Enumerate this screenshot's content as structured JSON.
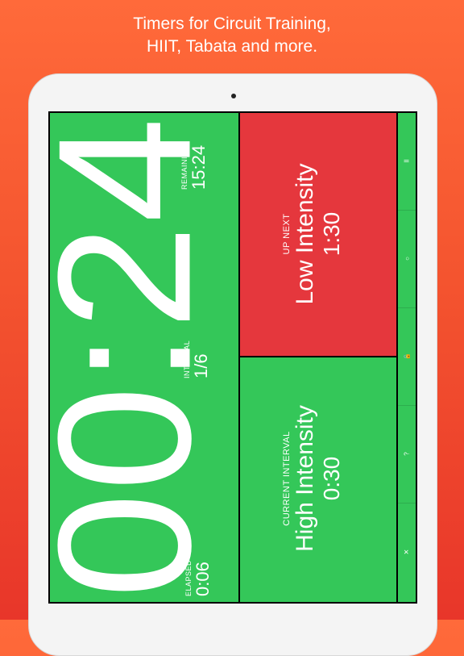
{
  "tagline": {
    "line1": "Timers for Circuit Training,",
    "line2": "HIIT, Tabata and more."
  },
  "timer": {
    "main_time": "00:24",
    "remaining_label": "REMAINING",
    "remaining_value": "15:24",
    "interval_label": "INTERVAL",
    "interval_value": "1/6",
    "elapsed_label": "ELAPSED",
    "elapsed_value": "0:06"
  },
  "up_next": {
    "label": "UP NEXT",
    "name": "Low Intensity",
    "time": "1:30"
  },
  "current_interval": {
    "label": "CURRENT INTERVAL",
    "name": "High Intensity",
    "time": "0:30"
  },
  "sidebar": {
    "pause_glyph": "II",
    "restart_glyph": "○",
    "lock_glyph": "🔓",
    "help_glyph": "?",
    "close_glyph": "×"
  },
  "colors": {
    "green": "#34c759",
    "red": "#e5373d",
    "background_top": "#ff6a3a",
    "background_bottom": "#e8362a"
  }
}
